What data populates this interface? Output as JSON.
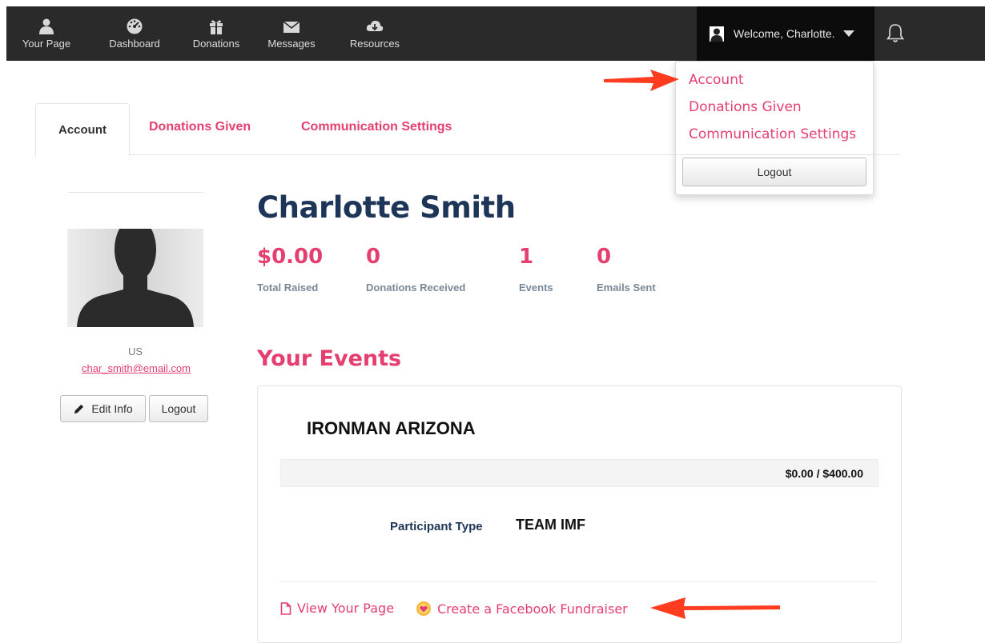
{
  "nav": {
    "items": [
      {
        "label": "Your Page",
        "icon": "user-icon"
      },
      {
        "label": "Dashboard",
        "icon": "dashboard-icon"
      },
      {
        "label": "Donations",
        "icon": "gift-icon"
      },
      {
        "label": "Messages",
        "icon": "envelope-icon"
      },
      {
        "label": "Resources",
        "icon": "cloud-download-icon"
      }
    ],
    "welcome_text": "Welcome, Charlotte."
  },
  "dropdown": {
    "items": [
      "Account",
      "Donations Given",
      "Communication Settings"
    ],
    "logout_label": "Logout"
  },
  "tabs": {
    "items": [
      "Account",
      "Donations Given",
      "Communication Settings"
    ],
    "active": "Account"
  },
  "profile": {
    "country": "US",
    "email": "char_smith@email.com",
    "edit_label": "Edit Info",
    "logout_label": "Logout"
  },
  "main": {
    "name": "Charlotte Smith",
    "stats": [
      {
        "value": "$0.00",
        "label": "Total Raised"
      },
      {
        "value": "0",
        "label": "Donations Received"
      },
      {
        "value": "1",
        "label": "Events"
      },
      {
        "value": "0",
        "label": "Emails Sent"
      }
    ],
    "events_heading": "Your Events",
    "event": {
      "title": "IRONMAN ARIZONA",
      "progress_text": "$0.00 / $400.00",
      "progress_fraction": 0.0,
      "participant_type_label": "Participant Type",
      "participant_type_value": "TEAM IMF",
      "view_page_label": "View Your Page",
      "facebook_label": "Create a Facebook Fundraiser"
    }
  },
  "colors": {
    "accent": "#e43f6f",
    "navy": "#1d3557",
    "topbar": "#2a2a2a",
    "annotation_arrow": "#ff3b20"
  }
}
